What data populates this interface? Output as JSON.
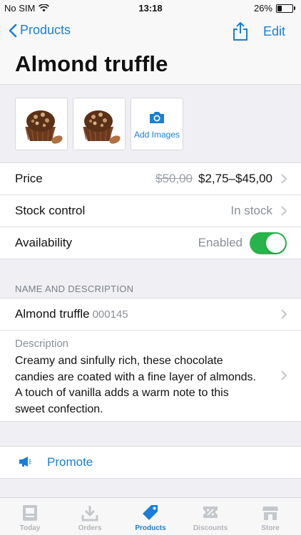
{
  "status": {
    "carrier": "No SIM",
    "time": "13:18",
    "battery": "26%"
  },
  "nav": {
    "back_label": "Products",
    "edit_label": "Edit"
  },
  "title": "Almond truffle",
  "images": {
    "add_label": "Add Images"
  },
  "details": {
    "price_label": "Price",
    "price_original": "$50,00",
    "price_current": "$2,75–$45,00",
    "stock_label": "Stock control",
    "stock_value": "In stock",
    "availability_label": "Availability",
    "availability_value": "Enabled"
  },
  "name_section": {
    "header": "NAME AND DESCRIPTION",
    "name": "Almond truffle",
    "sku": "000145",
    "description_label": "Description",
    "description": "Creamy and sinfully rich, these chocolate candies are coated with a fine layer of almonds. A touch of vanilla adds a warm note to this sweet confection."
  },
  "promote": {
    "label": "Promote"
  },
  "tabs": [
    {
      "label": "Today",
      "icon": "today-icon"
    },
    {
      "label": "Orders",
      "icon": "orders-icon"
    },
    {
      "label": "Products",
      "icon": "products-tag-icon"
    },
    {
      "label": "Discounts",
      "icon": "discounts-icon"
    },
    {
      "label": "Store",
      "icon": "store-icon"
    }
  ],
  "colors": {
    "accent": "#1a7fd6",
    "toggle_on": "#28b44a",
    "background": "#efeff4"
  }
}
